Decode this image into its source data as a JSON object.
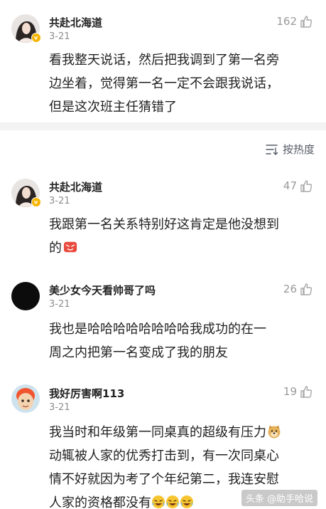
{
  "comments": [
    {
      "username": "共赴北海道",
      "date": "3-21",
      "likes": "162",
      "lines": [
        "看我整天说话，然后把我调到了第一名旁",
        "边坐着，觉得第一名一定不会跟我说话，",
        "但是这次班主任猜错了"
      ]
    },
    {
      "username": "共赴北海道",
      "date": "3-21",
      "likes": "47",
      "lines": [
        "我跟第一名关系特别好这肯定是他没想到",
        "的"
      ]
    },
    {
      "username": "美少女今天看帅哥了吗",
      "date": "3-21",
      "likes": "26",
      "lines": [
        "我也是哈哈哈哈哈哈哈哈我成功的在一",
        "周之内把第一名变成了我的朋友"
      ]
    },
    {
      "username": "我好厉害啊113",
      "date": "3-21",
      "likes": "19",
      "lines": [
        "我当时和年级第一同桌真的超级有压力",
        "动辄被人家的优秀打击到，有一次同桌心",
        "情不好就因为考了个年纪第二，我连安慰",
        "人家的资格都没有"
      ]
    }
  ],
  "sort": {
    "label": "按热度"
  },
  "watermark": "头条 @助手哈说",
  "icons": {
    "like": "thumbs-up-icon",
    "sort": "sort-list-icon",
    "verified": "verified-badge-icon"
  }
}
